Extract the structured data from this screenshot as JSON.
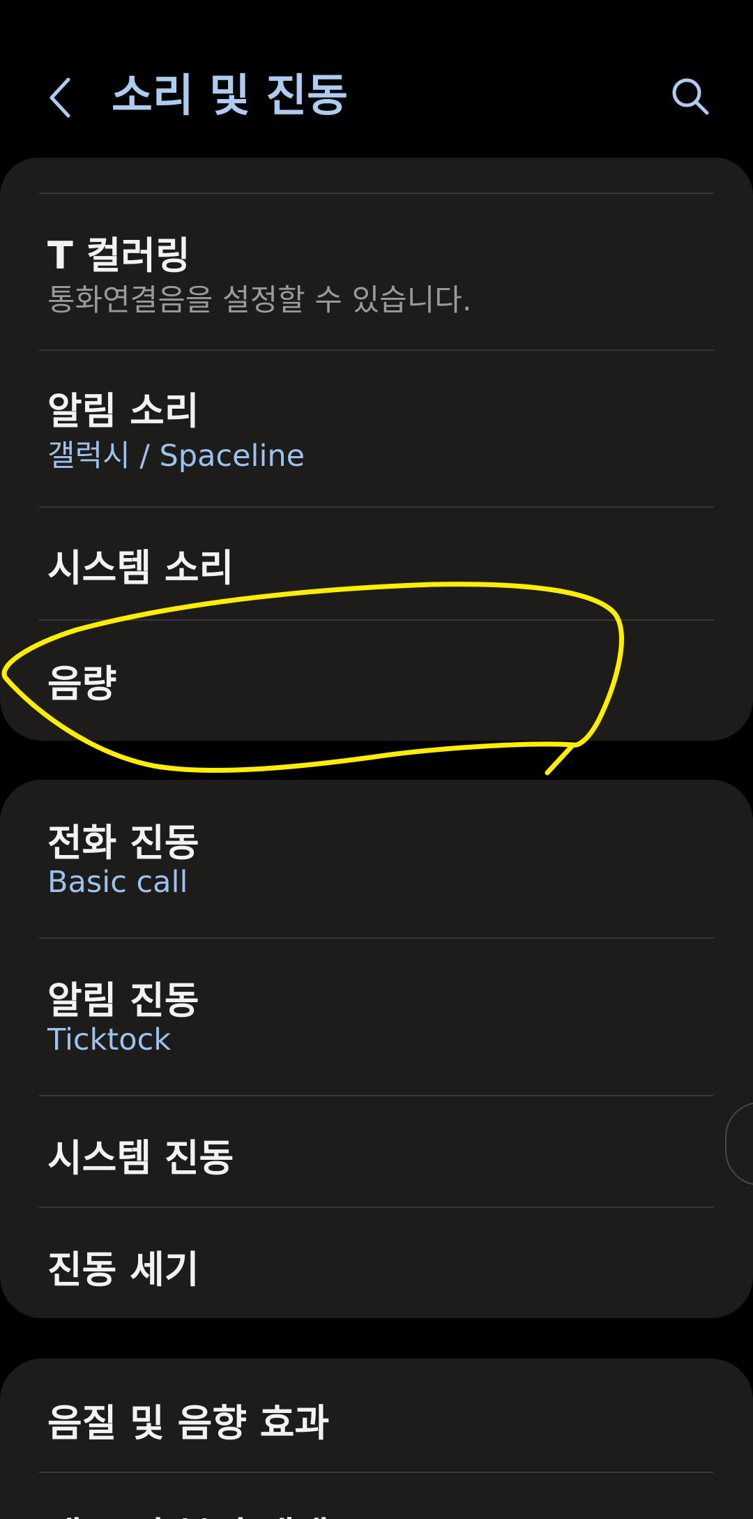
{
  "header": {
    "title": "소리 및 진동",
    "back_icon": "chevron-left-icon",
    "search_icon": "search-icon"
  },
  "colors": {
    "background": "#000000",
    "card": "#1e1c1b",
    "title": "#aecbf2",
    "value_blue": "#9cc2ef",
    "annotation": "#ffee00"
  },
  "group1": {
    "items": [
      {
        "label": "T 컬러링",
        "sub": "통화연결음을 설정할 수 있습니다."
      },
      {
        "label": "알림 소리",
        "sub": "갤럭시 / Spaceline"
      },
      {
        "label": "시스템 소리"
      },
      {
        "label": "음량"
      }
    ]
  },
  "group2": {
    "items": [
      {
        "label": "전화 진동",
        "sub": "Basic call"
      },
      {
        "label": "알림 진동",
        "sub": "Ticktock"
      },
      {
        "label": "시스템 진동"
      },
      {
        "label": "진동 세기"
      }
    ]
  },
  "group3": {
    "items": [
      {
        "label": "음질 및 음향 효과"
      },
      {
        "label": "앱 소리 분리 재생"
      }
    ]
  }
}
